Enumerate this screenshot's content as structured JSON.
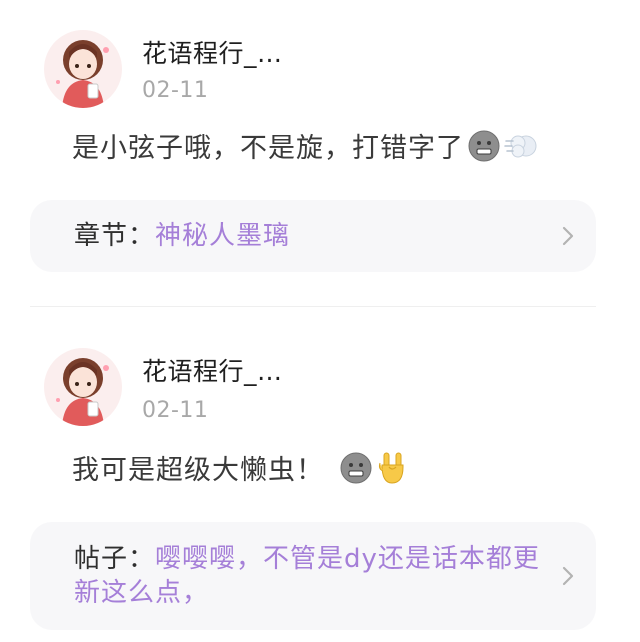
{
  "comments": [
    {
      "username": "花语程行_…",
      "date": "02-11",
      "text": "是小弦子哦，不是旋，打错字了",
      "emojis": [
        "grimace-face-icon",
        "puff-cloud-icon"
      ],
      "ref": {
        "prefix": "章节：",
        "title": "神秘人墨璃"
      }
    },
    {
      "username": "花语程行_…",
      "date": "02-11",
      "text": "我可是超级大懒虫！",
      "emojis": [
        "grimace-face-icon",
        "rock-hand-icon"
      ],
      "ref": {
        "prefix": "帖子：",
        "title": "嘤嘤嘤，不管是dy还是话本都更新这么点，"
      }
    }
  ],
  "colors": {
    "ref_title": "#a57fd8",
    "card_bg": "#f7f7f9",
    "date": "#a8a8a8"
  }
}
